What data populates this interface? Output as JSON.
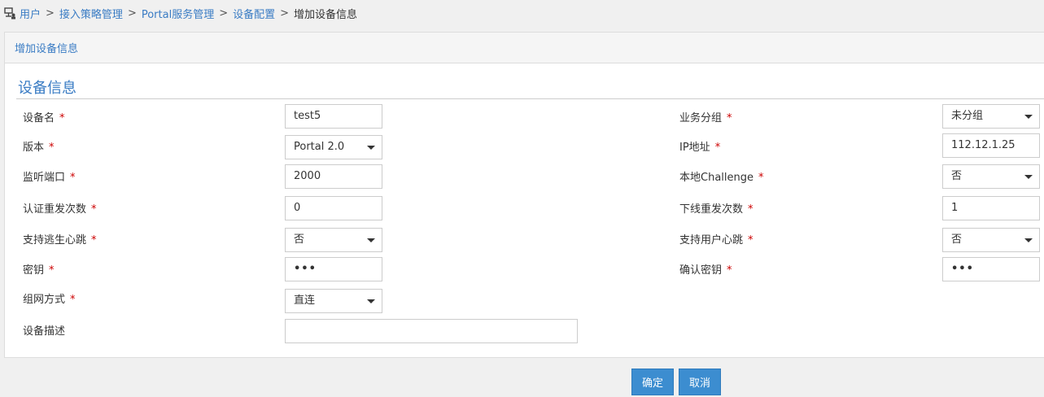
{
  "breadcrumb": {
    "items": [
      "用户",
      "接入策略管理",
      "Portal服务管理",
      "设备配置"
    ],
    "separator": ">",
    "current": "增加设备信息"
  },
  "panel": {
    "title": "增加设备信息"
  },
  "section": {
    "title": "设备信息"
  },
  "required_mark": "*",
  "fields": {
    "device_name": {
      "label": "设备名",
      "value": "test5"
    },
    "version": {
      "label": "版本",
      "value": "Portal 2.0"
    },
    "listen_port": {
      "label": "监听端口",
      "value": "2000"
    },
    "auth_retry": {
      "label": "认证重发次数",
      "value": "0"
    },
    "escape_heartbeat": {
      "label": "支持逃生心跳",
      "value": "否"
    },
    "key": {
      "label": "密钥",
      "value": "•••"
    },
    "network_mode": {
      "label": "组网方式",
      "value": "直连"
    },
    "description": {
      "label": "设备描述",
      "value": ""
    },
    "service_group": {
      "label": "业务分组",
      "value": "未分组"
    },
    "ip_address": {
      "label": "IP地址",
      "value": "112.12.1.25"
    },
    "local_challenge": {
      "label": "本地Challenge",
      "value": "否"
    },
    "offline_retry": {
      "label": "下线重发次数",
      "value": "1"
    },
    "user_heartbeat": {
      "label": "支持用户心跳",
      "value": "否"
    },
    "confirm_key": {
      "label": "确认密钥",
      "value": "•••"
    }
  },
  "buttons": {
    "ok": "确定",
    "cancel": "取消"
  },
  "colors": {
    "link": "#3a7cc4",
    "primary_button": "#3c8dd0",
    "required": "#cc0000"
  }
}
